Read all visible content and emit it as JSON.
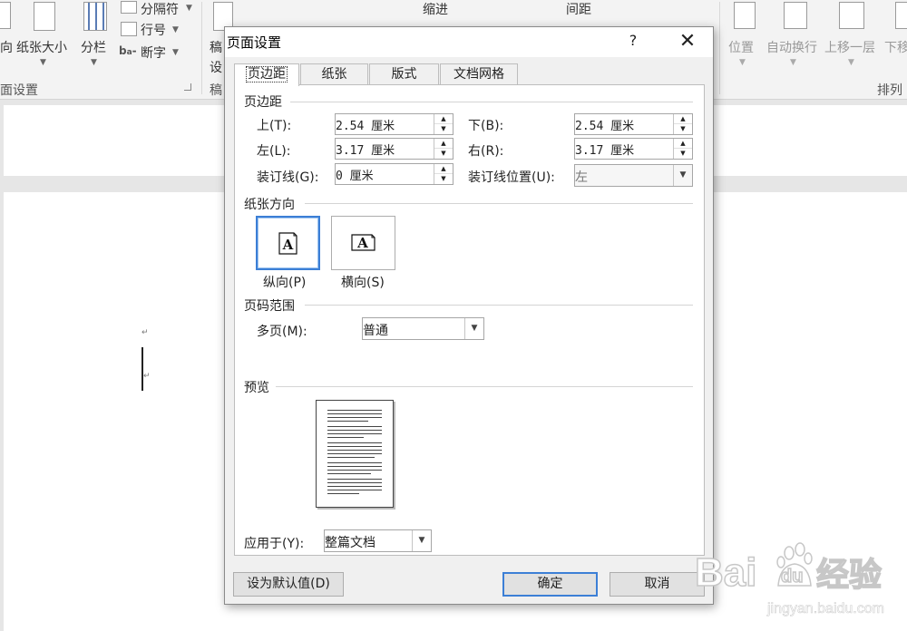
{
  "ribbon": {
    "orientation_label": "向",
    "size_label": "纸张大小",
    "columns_label": "分栏",
    "breaks_label": "分隔符",
    "line_numbers_label": "行号",
    "hyphenation_label": "断字",
    "page_setup_group": "面设置",
    "draft_label_1": "稿",
    "draft_label_2": "设",
    "draft_group": "稿",
    "indent_label": "缩进",
    "spacing_label": "间距",
    "position_label": "位置",
    "wrap_text_label": "自动换行",
    "bring_forward_label": "上移一层",
    "send_backward_label": "下移",
    "arrange_group": "排列"
  },
  "dialog": {
    "title": "页面设置",
    "help_glyph": "?",
    "close_glyph": "✕",
    "tabs": [
      {
        "label": "页边距",
        "active": true
      },
      {
        "label": "纸张",
        "active": false
      },
      {
        "label": "版式",
        "active": false
      },
      {
        "label": "文档网格",
        "active": false
      }
    ],
    "margins": {
      "section_title": "页边距",
      "top": {
        "label": "上(T):",
        "value": "2.54 厘米"
      },
      "bottom": {
        "label": "下(B):",
        "value": "2.54 厘米"
      },
      "left": {
        "label": "左(L):",
        "value": "3.17 厘米"
      },
      "right": {
        "label": "右(R):",
        "value": "3.17 厘米"
      },
      "gutter": {
        "label": "装订线(G):",
        "value": "0 厘米"
      },
      "gutter_position": {
        "label": "装订线位置(U):",
        "value": "左"
      }
    },
    "orientation": {
      "section_title": "纸张方向",
      "portrait_label": "纵向(P)",
      "landscape_label": "横向(S)",
      "selected": "portrait",
      "icon_letter": "A"
    },
    "pages": {
      "section_title": "页码范围",
      "multiple_pages_label": "多页(M):",
      "multiple_pages_value": "普通"
    },
    "preview": {
      "section_title": "预览",
      "apply_to_label": "应用于(Y):",
      "apply_to_value": "整篇文档"
    },
    "buttons": {
      "set_default": "设为默认值(D)",
      "ok": "确定",
      "cancel": "取消"
    }
  },
  "document": {
    "paragraph_mark": "↵"
  },
  "watermark": {
    "brand": "Bai",
    "brand_du": "du",
    "brand_cn": "经验",
    "url": "jingyan.baidu.com"
  },
  "colors": {
    "accent": "#3c7fd6",
    "ribbon_bg": "#f3f3f3",
    "dialog_bg": "#f0f0f0"
  },
  "icons": {
    "page_icon": "page-orientation-icon",
    "spin": "spin-arrows-icon",
    "dropdown": "chevron-down-icon"
  }
}
